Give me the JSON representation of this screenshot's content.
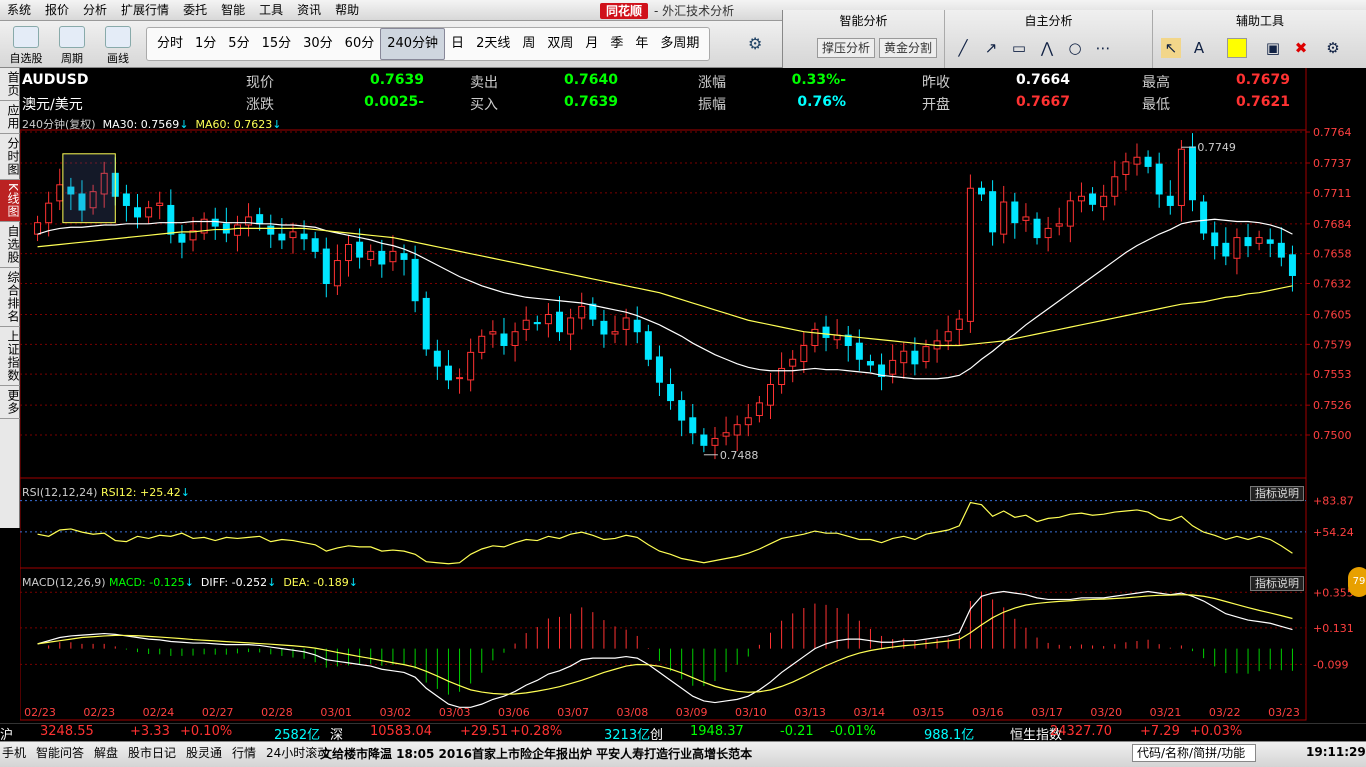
{
  "menu": [
    "系统",
    "报价",
    "分析",
    "扩展行情",
    "委托",
    "智能",
    "工具",
    "资讯",
    "帮助"
  ],
  "brand": {
    "logo": "同花顺",
    "subtitle": "- 外汇技术分析"
  },
  "toolbar": {
    "buttons": [
      "自选股",
      "周期",
      "画线"
    ],
    "periods": [
      "分时",
      "1分",
      "5分",
      "15分",
      "30分",
      "60分",
      "240分钟",
      "日",
      "2天线",
      "周",
      "双周",
      "月",
      "季",
      "年",
      "多周期"
    ],
    "active_period": "240分钟"
  },
  "right_toolbar": {
    "sections": [
      "智能分析",
      "自主分析",
      "辅助工具"
    ],
    "buttons": [
      "撑压分析",
      "黄金分割"
    ]
  },
  "sidetabs": [
    "首页",
    "应用",
    "分时图",
    "K线图",
    "自选股",
    "综合排名",
    "上证指数",
    "更多"
  ],
  "active_sidetab": "K线图",
  "quote": {
    "code": "AUDUSD",
    "name": "澳元/美元",
    "row1": [
      [
        "现价",
        "0.7639"
      ],
      [
        "卖出",
        "0.7640"
      ],
      [
        "涨幅",
        "-0.33%"
      ],
      [
        "昨收",
        "0.7664"
      ],
      [
        "最高",
        "0.7679"
      ]
    ],
    "row2": [
      [
        "涨跌",
        "-0.0025"
      ],
      [
        "买入",
        "0.7639"
      ],
      [
        "振幅",
        "0.76%"
      ],
      [
        "开盘",
        "0.7667"
      ],
      [
        "最低",
        "0.7621"
      ]
    ]
  },
  "ma_legend": {
    "label": "240分钟(复权)",
    "ma30": "MA30: 0.7569",
    "ma60": "MA60: 0.7623"
  },
  "rsi_legend": {
    "label": "RSI(12,12,24)",
    "value": "RSI12: +25.42"
  },
  "macd_legend": {
    "label": "MACD(12,26,9)",
    "macd": "MACD: -0.125",
    "diff": "DIFF: -0.252",
    "dea": "DEA: -0.189"
  },
  "hint_label": "指标说明",
  "chart_data": [
    {
      "type": "candlestick",
      "title": "AUDUSD 240分钟",
      "y_ticks": [
        "0.7764",
        "0.7737",
        "0.7711",
        "0.7684",
        "0.7658",
        "0.7632",
        "0.7605",
        "0.7579",
        "0.7553",
        "0.7526",
        "0.7500"
      ],
      "ylim": [
        0.7473,
        0.7764
      ],
      "x_labels": [
        "02/23",
        "02/23",
        "02/24",
        "02/27",
        "02/28",
        "03/01",
        "03/02",
        "03/03",
        "03/06",
        "03/07",
        "03/08",
        "03/09",
        "03/10",
        "03/13",
        "03/14",
        "03/15",
        "03/16",
        "03/17",
        "03/20",
        "03/21",
        "03/22",
        "03/23"
      ],
      "annotations": [
        {
          "text": "0.7749",
          "value": 0.7749
        },
        {
          "text": "0.7488",
          "value": 0.7488
        }
      ],
      "close": [
        0.7685,
        0.7702,
        0.7718,
        0.771,
        0.7696,
        0.7712,
        0.7728,
        0.7708,
        0.77,
        0.769,
        0.7698,
        0.7702,
        0.7675,
        0.7668,
        0.7678,
        0.7688,
        0.7682,
        0.7676,
        0.7683,
        0.769,
        0.7684,
        0.7675,
        0.767,
        0.7677,
        0.7671,
        0.766,
        0.7632,
        0.7652,
        0.7666,
        0.7655,
        0.766,
        0.7649,
        0.766,
        0.7653,
        0.7617,
        0.7575,
        0.756,
        0.7548,
        0.755,
        0.7572,
        0.7586,
        0.759,
        0.7578,
        0.759,
        0.76,
        0.7597,
        0.7605,
        0.759,
        0.7602,
        0.7612,
        0.7601,
        0.7588,
        0.759,
        0.7602,
        0.759,
        0.7566,
        0.7546,
        0.753,
        0.7513,
        0.7502,
        0.7491,
        0.7497,
        0.7502,
        0.7509,
        0.7515,
        0.7528,
        0.7544,
        0.7558,
        0.7566,
        0.7578,
        0.7592,
        0.7585,
        0.7587,
        0.7578,
        0.7566,
        0.7561,
        0.7551,
        0.7565,
        0.7573,
        0.7562,
        0.7577,
        0.7582,
        0.759,
        0.7601,
        0.7715,
        0.771,
        0.7677,
        0.7703,
        0.7685,
        0.769,
        0.7672,
        0.768,
        0.7684,
        0.7704,
        0.7708,
        0.7701,
        0.7708,
        0.7725,
        0.7738,
        0.7742,
        0.7734,
        0.771,
        0.77,
        0.7749,
        0.7705,
        0.7676,
        0.7665,
        0.7656,
        0.7672,
        0.7665,
        0.7672,
        0.7667,
        0.7655,
        0.7639
      ],
      "ma30": [
        0.7675,
        0.7678,
        0.768,
        0.7681,
        0.7681,
        0.7682,
        0.7683,
        0.7683,
        0.7684,
        0.7684,
        0.7684,
        0.7685,
        0.7685,
        0.7685,
        0.7686,
        0.7686,
        0.7686,
        0.7685,
        0.7685,
        0.7685,
        0.7684,
        0.7684,
        0.7683,
        0.7683,
        0.7682,
        0.7681,
        0.7678,
        0.7676,
        0.7674,
        0.7672,
        0.767,
        0.7667,
        0.7665,
        0.7662,
        0.7658,
        0.7653,
        0.7648,
        0.7643,
        0.7638,
        0.7634,
        0.763,
        0.7627,
        0.7624,
        0.7622,
        0.762,
        0.7619,
        0.7618,
        0.7617,
        0.7616,
        0.7615,
        0.7613,
        0.7611,
        0.7609,
        0.7607,
        0.7604,
        0.76,
        0.7596,
        0.7591,
        0.7586,
        0.758,
        0.7575,
        0.757,
        0.7566,
        0.7562,
        0.7559,
        0.7557,
        0.7556,
        0.7556,
        0.7556,
        0.7557,
        0.7558,
        0.7557,
        0.7557,
        0.7556,
        0.7555,
        0.7554,
        0.7552,
        0.7551,
        0.755,
        0.7549,
        0.7549,
        0.7549,
        0.755,
        0.7552,
        0.7558,
        0.7566,
        0.7573,
        0.7581,
        0.7588,
        0.7596,
        0.7603,
        0.761,
        0.7617,
        0.7624,
        0.7631,
        0.7638,
        0.7645,
        0.7652,
        0.7659,
        0.7665,
        0.767,
        0.7675,
        0.7679,
        0.7684,
        0.7686,
        0.7687,
        0.7688,
        0.7687,
        0.7686,
        0.7686,
        0.7685,
        0.7683,
        0.768,
        0.7675
      ],
      "ma60": [
        0.7664,
        0.7665,
        0.7666,
        0.7667,
        0.7668,
        0.7669,
        0.767,
        0.7671,
        0.7672,
        0.7673,
        0.7674,
        0.7675,
        0.7676,
        0.7677,
        0.7677,
        0.7678,
        0.7679,
        0.7679,
        0.768,
        0.768,
        0.768,
        0.768,
        0.768,
        0.768,
        0.768,
        0.7679,
        0.7678,
        0.7677,
        0.7676,
        0.7675,
        0.7674,
        0.7673,
        0.7672,
        0.767,
        0.7668,
        0.7666,
        0.7664,
        0.7662,
        0.766,
        0.7658,
        0.7656,
        0.7654,
        0.7652,
        0.765,
        0.7648,
        0.7646,
        0.7644,
        0.7642,
        0.764,
        0.7638,
        0.7636,
        0.7634,
        0.7632,
        0.763,
        0.7628,
        0.7626,
        0.7624,
        0.7621,
        0.7618,
        0.7615,
        0.7612,
        0.7609,
        0.7606,
        0.7603,
        0.76,
        0.7598,
        0.7596,
        0.7594,
        0.7592,
        0.759,
        0.7589,
        0.7588,
        0.7587,
        0.7586,
        0.7585,
        0.7584,
        0.7583,
        0.7582,
        0.7581,
        0.758,
        0.7579,
        0.7578,
        0.7578,
        0.7578,
        0.7579,
        0.758,
        0.7581,
        0.7582,
        0.7584,
        0.7586,
        0.7588,
        0.759,
        0.7592,
        0.7594,
        0.7596,
        0.7598,
        0.76,
        0.7602,
        0.7604,
        0.7606,
        0.7608,
        0.761,
        0.7612,
        0.7614,
        0.7615,
        0.7616,
        0.7618,
        0.762,
        0.7621,
        0.7623,
        0.7624,
        0.7626,
        0.7628,
        0.763
      ]
    },
    {
      "type": "line",
      "title": "RSI(12,12,24)",
      "y_ticks": [
        "+83.87",
        "+54.24"
      ],
      "ylim": [
        20,
        92
      ],
      "values": [
        52,
        50,
        56,
        57,
        54,
        52,
        53,
        46,
        45,
        50,
        48,
        51,
        50,
        53,
        48,
        49,
        46,
        49,
        48,
        49,
        50,
        45,
        47,
        46,
        44,
        42,
        36,
        39,
        41,
        40,
        40,
        36,
        37,
        36,
        33,
        26,
        25,
        24,
        25,
        33,
        38,
        41,
        40,
        44,
        47,
        46,
        50,
        48,
        52,
        54,
        51,
        47,
        48,
        51,
        49,
        42,
        36,
        33,
        29,
        27,
        25,
        27,
        29,
        31,
        34,
        38,
        43,
        48,
        50,
        52,
        55,
        53,
        53,
        50,
        47,
        47,
        44,
        48,
        50,
        47,
        52,
        54,
        56,
        60,
        82,
        80,
        69,
        74,
        68,
        70,
        64,
        67,
        68,
        71,
        72,
        70,
        71,
        73,
        74,
        75,
        73,
        67,
        65,
        69,
        60,
        54,
        51,
        47,
        50,
        47,
        50,
        47,
        41,
        34
      ]
    },
    {
      "type": "bar+line",
      "title": "MACD(12,26,9)",
      "y_ticks": [
        "+0.355",
        "+0.131",
        "-0.099"
      ],
      "ylim": [
        -0.45,
        0.42
      ],
      "diff": [
        0.03,
        0.05,
        0.07,
        0.08,
        0.085,
        0.09,
        0.095,
        0.09,
        0.08,
        0.07,
        0.06,
        0.055,
        0.045,
        0.04,
        0.035,
        0.035,
        0.03,
        0.025,
        0.025,
        0.025,
        0.02,
        0.01,
        0.0,
        -0.01,
        -0.02,
        -0.04,
        -0.07,
        -0.08,
        -0.09,
        -0.1,
        -0.11,
        -0.13,
        -0.14,
        -0.15,
        -0.18,
        -0.25,
        -0.3,
        -0.35,
        -0.37,
        -0.37,
        -0.35,
        -0.32,
        -0.3,
        -0.27,
        -0.23,
        -0.2,
        -0.16,
        -0.14,
        -0.11,
        -0.07,
        -0.06,
        -0.06,
        -0.06,
        -0.05,
        -0.06,
        -0.1,
        -0.15,
        -0.2,
        -0.25,
        -0.3,
        -0.33,
        -0.34,
        -0.33,
        -0.32,
        -0.3,
        -0.26,
        -0.21,
        -0.15,
        -0.1,
        -0.05,
        0.0,
        0.03,
        0.05,
        0.06,
        0.06,
        0.05,
        0.04,
        0.04,
        0.05,
        0.05,
        0.06,
        0.07,
        0.08,
        0.1,
        0.25,
        0.33,
        0.35,
        0.36,
        0.35,
        0.34,
        0.32,
        0.31,
        0.31,
        0.31,
        0.32,
        0.32,
        0.32,
        0.33,
        0.34,
        0.35,
        0.36,
        0.35,
        0.34,
        0.35,
        0.33,
        0.3,
        0.26,
        0.22,
        0.2,
        0.18,
        0.17,
        0.16,
        0.14,
        0.12
      ],
      "dea": [
        0.03,
        0.04,
        0.05,
        0.06,
        0.07,
        0.075,
        0.08,
        0.083,
        0.083,
        0.081,
        0.077,
        0.073,
        0.068,
        0.063,
        0.057,
        0.053,
        0.049,
        0.044,
        0.04,
        0.036,
        0.032,
        0.028,
        0.023,
        0.018,
        0.012,
        0.003,
        -0.01,
        -0.024,
        -0.037,
        -0.05,
        -0.062,
        -0.076,
        -0.089,
        -0.101,
        -0.117,
        -0.143,
        -0.173,
        -0.205,
        -0.234,
        -0.26,
        -0.274,
        -0.283,
        -0.287,
        -0.286,
        -0.279,
        -0.268,
        -0.255,
        -0.24,
        -0.22,
        -0.2,
        -0.175,
        -0.15,
        -0.13,
        -0.11,
        -0.1,
        -0.102,
        -0.111,
        -0.129,
        -0.153,
        -0.183,
        -0.212,
        -0.238,
        -0.256,
        -0.269,
        -0.275,
        -0.272,
        -0.26,
        -0.238,
        -0.211,
        -0.178,
        -0.142,
        -0.108,
        -0.078,
        -0.05,
        -0.028,
        -0.012,
        0.0,
        0.01,
        0.018,
        0.024,
        0.032,
        0.04,
        0.048,
        0.058,
        0.1,
        0.15,
        0.195,
        0.23,
        0.256,
        0.275,
        0.285,
        0.292,
        0.298,
        0.302,
        0.307,
        0.31,
        0.312,
        0.316,
        0.32,
        0.326,
        0.332,
        0.336,
        0.337,
        0.34,
        0.338,
        0.33,
        0.316,
        0.297,
        0.278,
        0.259,
        0.241,
        0.225,
        0.208,
        0.19
      ]
    }
  ],
  "market_strip": [
    {
      "name": "沪",
      "value": "3248.55",
      "change": "+3.33",
      "pct": "+0.10%",
      "amount": "2582亿"
    },
    {
      "name": "深",
      "value": "10583.04",
      "change": "+29.51",
      "pct": "+0.28%",
      "amount": "3213亿"
    },
    {
      "name": "创",
      "value": "1948.37",
      "change": "-0.21",
      "pct": "-0.01%",
      "amount": "988.1亿"
    },
    {
      "name": "恒生指数",
      "value": "24327.70",
      "change": "+7.29",
      "pct": "+0.03%",
      "amount": ""
    }
  ],
  "status": {
    "items": [
      "手机",
      "智能问答",
      "解盘",
      "股市日记",
      "股灵通",
      "行情",
      "24小时滚动"
    ],
    "ticker": "文给楼市降温   18:05 2016首家上市险企年报出炉 平安人寿打造行业高增长范本",
    "search_placeholder": "代码/名称/简拼/功能",
    "clock": "19:11:29"
  },
  "bubble": "79",
  "colors": {
    "up": "#ff3232",
    "down": "#00e5ff",
    "ma30": "#ffffff",
    "ma60": "#ffff55",
    "grid": "#7a0000",
    "axis": "#a00000"
  }
}
